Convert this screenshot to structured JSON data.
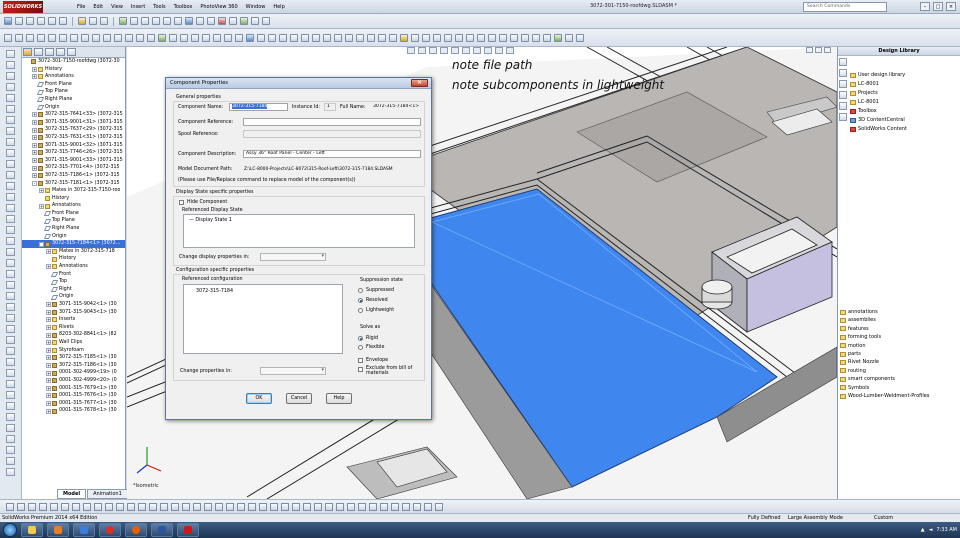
{
  "app": {
    "logo": "SOLIDWORKS",
    "menu": [
      "File",
      "Edit",
      "View",
      "Insert",
      "Tools",
      "Toolbox",
      "PhotoView 360",
      "Window",
      "Help"
    ],
    "doc_title": "3072-301-7150-roofdwg.SLDASM *",
    "search_placeholder": "Search Commands"
  },
  "feature_tree": {
    "tabs": [
      "model",
      "property",
      "config",
      "display",
      "appearance"
    ],
    "items": [
      {
        "text": "3072-301-7150-roofdwg (3072-30",
        "type": "asm",
        "indent": 0,
        "pm": ""
      },
      {
        "text": "History",
        "type": "folder",
        "indent": 1,
        "pm": "+"
      },
      {
        "text": "Annotations",
        "type": "folder",
        "indent": 1,
        "pm": "+"
      },
      {
        "text": "Front Plane",
        "type": "plane",
        "indent": 1,
        "pm": ""
      },
      {
        "text": "Top Plane",
        "type": "plane",
        "indent": 1,
        "pm": ""
      },
      {
        "text": "Right Plane",
        "type": "plane",
        "indent": 1,
        "pm": ""
      },
      {
        "text": "Origin",
        "type": "plane",
        "indent": 1,
        "pm": ""
      },
      {
        "text": "3072-315-7641<33> (3072-315",
        "type": "asm",
        "indent": 1,
        "pm": "+"
      },
      {
        "text": "3071-315-9001<31> (3071-315",
        "type": "asm",
        "indent": 1,
        "pm": "+"
      },
      {
        "text": "3072-315-7637<29> (3072-315",
        "type": "asm",
        "indent": 1,
        "pm": "+"
      },
      {
        "text": "3072-315-7631<31> (3072-315",
        "type": "asm",
        "indent": 1,
        "pm": "+"
      },
      {
        "text": "3071-315-9001<32> (3071-315",
        "type": "asm",
        "indent": 1,
        "pm": "+"
      },
      {
        "text": "3072-315-7746<26> (3072-315",
        "type": "asm",
        "indent": 1,
        "pm": "+"
      },
      {
        "text": "3071-315-9001<33> (3071-315",
        "type": "asm",
        "indent": 1,
        "pm": "+"
      },
      {
        "text": "3072-315-7701<4> (3072-315",
        "type": "asm",
        "indent": 1,
        "pm": "+"
      },
      {
        "text": "3072-315-7186<1> (3072-315",
        "type": "asm",
        "indent": 1,
        "pm": "+"
      },
      {
        "text": "3072-315-7181<1> (3072-315",
        "type": "asm",
        "indent": 1,
        "pm": "-"
      },
      {
        "text": "Mates in 3072-315-7150-roo",
        "type": "folder",
        "indent": 2,
        "pm": "+"
      },
      {
        "text": "History",
        "type": "folder",
        "indent": 2,
        "pm": ""
      },
      {
        "text": "Annotations",
        "type": "folder",
        "indent": 2,
        "pm": "+"
      },
      {
        "text": "Front Plane",
        "type": "plane",
        "indent": 2,
        "pm": ""
      },
      {
        "text": "Top Plane",
        "type": "plane",
        "indent": 2,
        "pm": ""
      },
      {
        "text": "Right Plane",
        "type": "plane",
        "indent": 2,
        "pm": ""
      },
      {
        "text": "Origin",
        "type": "plane",
        "indent": 2,
        "pm": ""
      },
      {
        "text": "3072-315-7184<1> (3072...",
        "type": "asm",
        "indent": 2,
        "pm": "-",
        "selected": true
      },
      {
        "text": "Mates in 3072-315-718",
        "type": "folder",
        "indent": 3,
        "pm": "+"
      },
      {
        "text": "History",
        "type": "folder",
        "indent": 3,
        "pm": ""
      },
      {
        "text": "Annotations",
        "type": "folder",
        "indent": 3,
        "pm": "+"
      },
      {
        "text": "Front",
        "type": "plane",
        "indent": 3,
        "pm": ""
      },
      {
        "text": "Top",
        "type": "plane",
        "indent": 3,
        "pm": ""
      },
      {
        "text": "Right",
        "type": "plane",
        "indent": 3,
        "pm": ""
      },
      {
        "text": "Origin",
        "type": "plane",
        "indent": 3,
        "pm": ""
      },
      {
        "text": "3071-315-9042<1> (30",
        "type": "asm",
        "indent": 3,
        "pm": "+"
      },
      {
        "text": "3071-315-9043<1> (30",
        "type": "asm",
        "indent": 3,
        "pm": "+"
      },
      {
        "text": "Inserts",
        "type": "folder",
        "indent": 3,
        "pm": "+"
      },
      {
        "text": "Rivets",
        "type": "folder",
        "indent": 3,
        "pm": "+"
      },
      {
        "text": "8203-302-8841<1> (82",
        "type": "asm",
        "indent": 3,
        "pm": "+"
      },
      {
        "text": "Wall Clips",
        "type": "folder",
        "indent": 3,
        "pm": "+"
      },
      {
        "text": "Styrofoam",
        "type": "folder",
        "indent": 3,
        "pm": "+"
      },
      {
        "text": "3072-315-7185<1> (30",
        "type": "asm",
        "indent": 3,
        "pm": "+"
      },
      {
        "text": "3072-315-7186<1> (30",
        "type": "asm",
        "indent": 3,
        "pm": "+"
      },
      {
        "text": "0001-302-4999<19> (0",
        "type": "asm",
        "indent": 3,
        "pm": "+"
      },
      {
        "text": "0001-302-4999<20> (0",
        "type": "asm",
        "indent": 3,
        "pm": "+"
      },
      {
        "text": "0001-315-7679<1> (30",
        "type": "asm",
        "indent": 3,
        "pm": "+"
      },
      {
        "text": "0001-315-7676<1> (30",
        "type": "asm",
        "indent": 3,
        "pm": "+"
      },
      {
        "text": "0001-315-7677<1> (30",
        "type": "asm",
        "indent": 3,
        "pm": "+"
      },
      {
        "text": "0001-315-7678<1> (30",
        "type": "asm",
        "indent": 3,
        "pm": "+"
      }
    ],
    "bottom_tabs": [
      "Model",
      "Animation1"
    ]
  },
  "viewport": {
    "note1": "note file path",
    "note2": "note subcomponents in lightweight",
    "view_label": "*Isometric",
    "panel_color": "#3f87ee"
  },
  "design_library": {
    "title": "Design Library",
    "items": [
      {
        "text": "User design library",
        "color": "folder"
      },
      {
        "text": "LC-8001",
        "color": "folder"
      },
      {
        "text": "Projects",
        "color": "folder"
      },
      {
        "text": "LC-8001",
        "color": "folder"
      },
      {
        "text": "Toolbox",
        "color": "red"
      },
      {
        "text": "3D ContentCentral",
        "color": "blue"
      },
      {
        "text": "SolidWorks Content",
        "color": "red"
      }
    ],
    "folders": [
      "annotations",
      "assemblies",
      "features",
      "forming tools",
      "motion",
      "parts",
      "Rivet Nozzle",
      "routing",
      "smart components",
      "Symbols",
      "Wood-Lumber-Weldment-Profiles"
    ]
  },
  "dialog": {
    "title": "Component Properties",
    "general_header": "General properties",
    "component_name_label": "Component Name:",
    "component_name_value": "3072-315-7184",
    "instance_id_label": "Instance Id:",
    "instance_id_value": "1",
    "full_name_label": "Full Name:",
    "full_name_value": "3072-315-7184<1>",
    "component_reference_label": "Component Reference:",
    "spool_reference_label": "Spool Reference:",
    "component_description_label": "Component Description:",
    "component_description_value": "Assy 36\" Roof Panel - Center - Left",
    "model_path_label": "Model Document Path:",
    "model_path_value": "Z:\\LC-8000-Projects\\LC-8072\\315-Roof-Left\\3072-315-7184.SLDASM",
    "replace_note": "(Please use File/Replace command to replace model of the component(s))",
    "display_state_header": "Display State specific properties",
    "hide_component_label": "Hide Component",
    "referenced_display_state_label": "Referenced Display State",
    "display_state_item": "Display State 1",
    "change_display_label": "Change display properties in:",
    "config_header": "Configuration specific properties",
    "referenced_config_label": "Referenced configuration",
    "config_item": "3072-315-7184",
    "suppression_label": "Suppression state",
    "suppressed_label": "Suppressed",
    "resolved_label": "Resolved",
    "lightweight_label": "Lightweight",
    "solve_as_label": "Solve as",
    "rigid_label": "Rigid",
    "flexible_label": "Flexible",
    "envelope_label": "Envelope",
    "exclude_bom_label": "Exclude from bill of materials",
    "change_props_label": "Change properties in:",
    "ok_label": "OK",
    "cancel_label": "Cancel",
    "help_label": "Help"
  },
  "status": {
    "left": "SolidWorks Premium 2014 x64 Edition",
    "state1": "Fully Defined",
    "state2": "Large Assembly Mode",
    "units": "Custom"
  },
  "taskbar": {
    "clock": "7:33 AM"
  }
}
